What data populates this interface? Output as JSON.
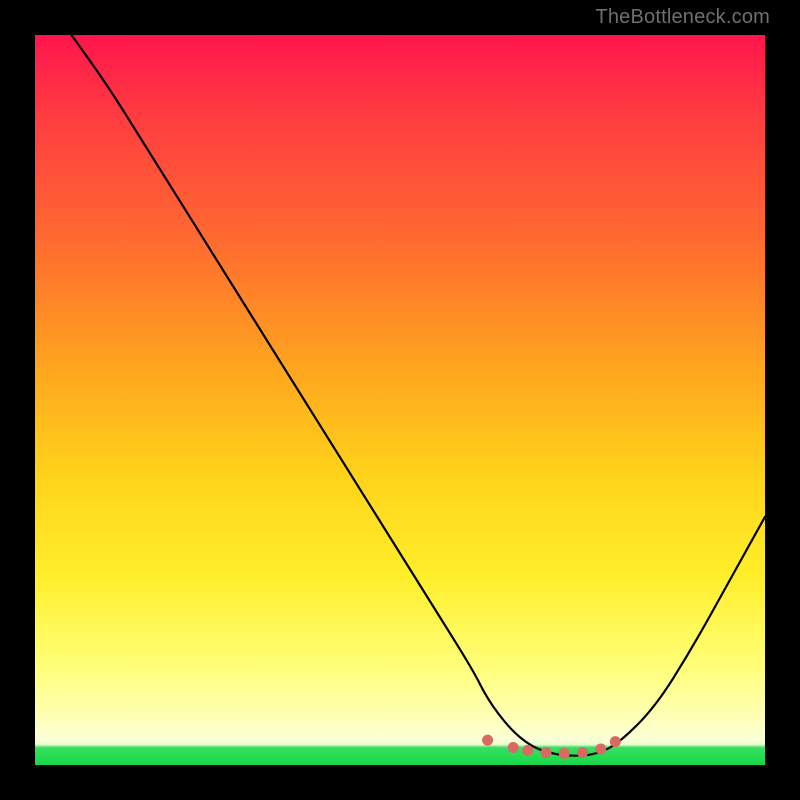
{
  "watermark": "TheBottleneck.com",
  "chart_data": {
    "type": "line",
    "title": "",
    "xlabel": "",
    "ylabel": "",
    "xlim": [
      0,
      100
    ],
    "ylim": [
      0,
      100
    ],
    "series": [
      {
        "name": "bottleneck-curve",
        "x": [
          5,
          10,
          15,
          20,
          25,
          30,
          35,
          40,
          45,
          50,
          55,
          60,
          62,
          65,
          68,
          71,
          74,
          77,
          80,
          85,
          90,
          95,
          100
        ],
        "y": [
          100,
          93,
          85,
          77,
          69,
          61,
          53,
          45,
          37,
          29,
          21,
          13,
          9,
          5,
          2.5,
          1.5,
          1.2,
          1.5,
          3,
          8,
          16,
          25,
          34
        ]
      }
    ],
    "markers": {
      "name": "optimal-range-dots",
      "x": [
        62,
        65.5,
        67.5,
        70,
        72.5,
        75,
        77.5,
        79.5
      ],
      "y": [
        3.4,
        2.4,
        2.0,
        1.7,
        1.6,
        1.7,
        2.2,
        3.2
      ],
      "color": "#d86a62"
    },
    "gradient_stops": [
      {
        "pos": 0.0,
        "color": "#ff154d"
      },
      {
        "pos": 0.45,
        "color": "#ffa31f"
      },
      {
        "pos": 0.86,
        "color": "#ffff76"
      },
      {
        "pos": 0.976,
        "color": "#38e060"
      },
      {
        "pos": 1.0,
        "color": "#16d848"
      }
    ]
  }
}
